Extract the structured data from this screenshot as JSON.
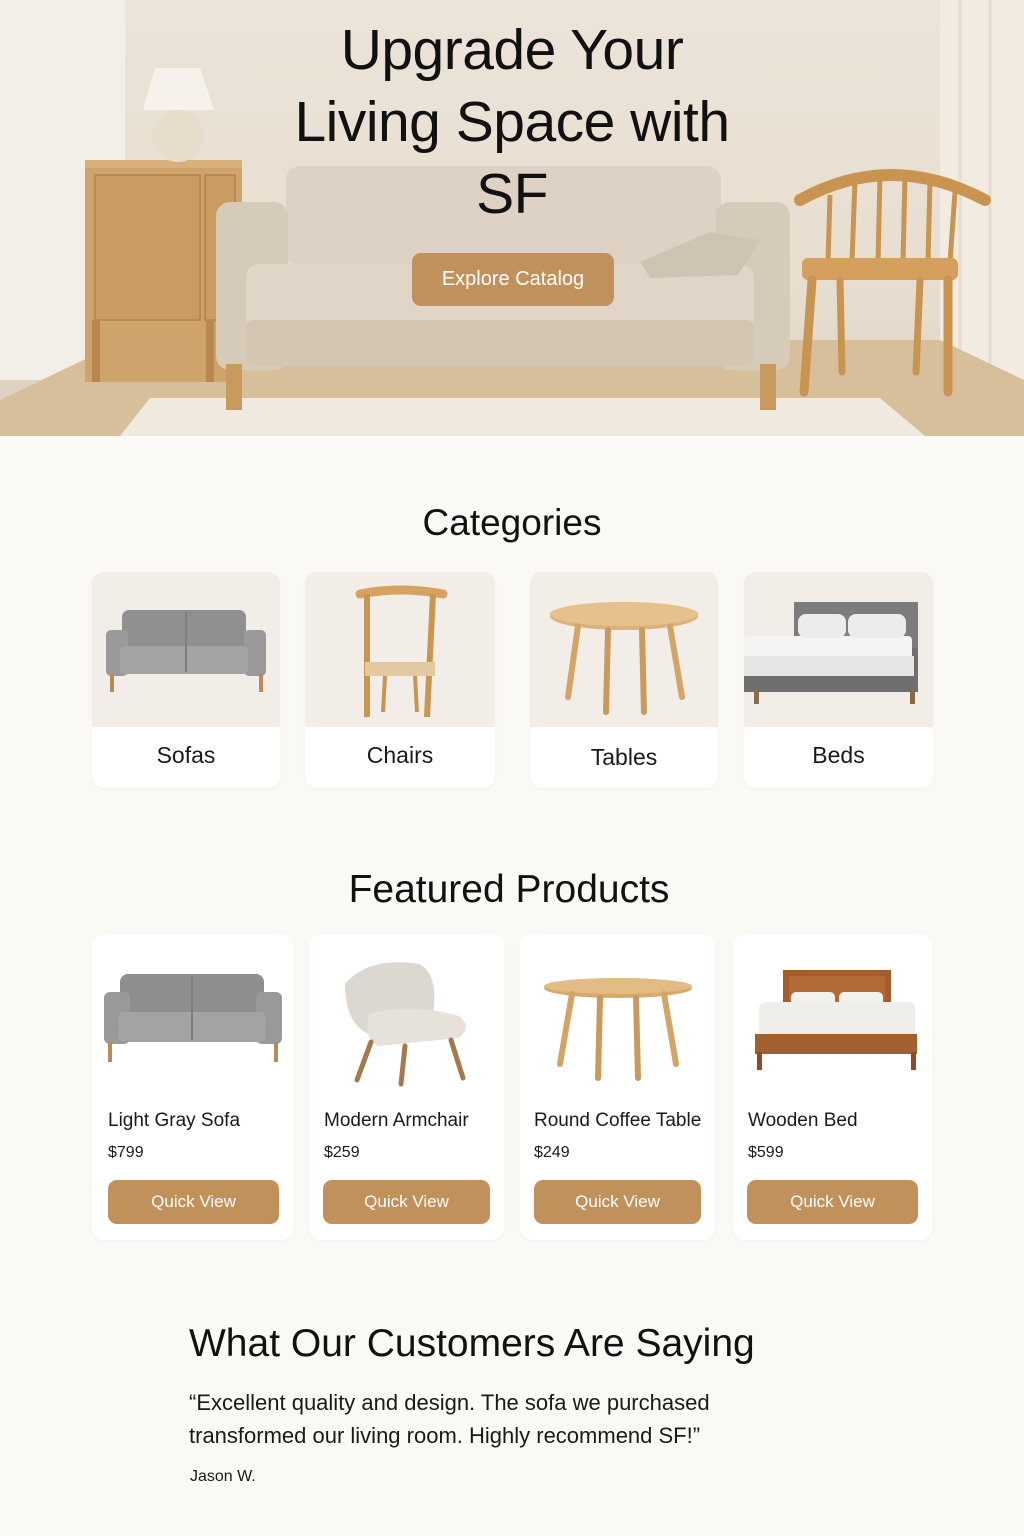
{
  "hero": {
    "title_line1": "Upgrade Your",
    "title_line2": "Living Space with",
    "title_line3": "SF",
    "cta_label": "Explore Catalog"
  },
  "categories": {
    "title": "Categories",
    "items": [
      {
        "label": "Sofas",
        "icon": "sofa-icon"
      },
      {
        "label": "Chairs",
        "icon": "chair-icon"
      },
      {
        "label": "Tables",
        "icon": "table-icon"
      },
      {
        "label": "Beds",
        "icon": "bed-icon"
      }
    ]
  },
  "featured": {
    "title": "Featured Products",
    "products": [
      {
        "name": "Light Gray Sofa",
        "price": "$799",
        "button": "Quick View"
      },
      {
        "name": "Modern Armchair",
        "price": "$259",
        "button": "Quick View"
      },
      {
        "name": "Round Coffee Table",
        "price": "$249",
        "button": "Quick View"
      },
      {
        "name": "Wooden Bed",
        "price": "$599",
        "button": "Quick View"
      }
    ]
  },
  "testimonial": {
    "title": "What Our Customers Are Saying",
    "quote_line1": "“Excellent quality and design. The sofa we purchased",
    "quote_line2": "transformed our living room. Highly recommend SF!”",
    "author": "Jason W."
  },
  "colors": {
    "accent": "#c0915a",
    "background": "#fbf9f5",
    "card": "#ffffff",
    "text": "#141414"
  }
}
